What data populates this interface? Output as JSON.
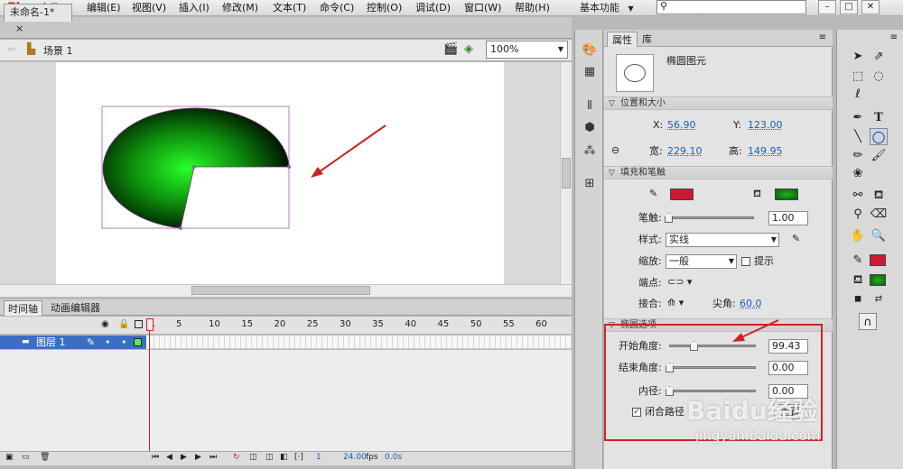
{
  "app": {
    "logo": "Fl",
    "workspace": "基本功能"
  },
  "menu": [
    "文件(F)",
    "编辑(E)",
    "视图(V)",
    "插入(I)",
    "修改(M)",
    "文本(T)",
    "命令(C)",
    "控制(O)",
    "调试(D)",
    "窗口(W)",
    "帮助(H)"
  ],
  "document": {
    "tab_title": "未命名-1*",
    "tab_close": "×",
    "scene": "场景 1",
    "zoom": "100%"
  },
  "timeline": {
    "tabs": [
      "时间轴",
      "动画编辑器"
    ],
    "frame_numbers": [
      "1",
      "5",
      "10",
      "15",
      "20",
      "25",
      "30",
      "35",
      "40",
      "45",
      "50",
      "55",
      "60"
    ],
    "layer_name": "图层 1",
    "footer": {
      "current_frame": "1",
      "fps": "24.00",
      "fps_unit": "fps",
      "time": "0.0s"
    }
  },
  "properties": {
    "tabs": [
      "属性",
      "库"
    ],
    "object_type": "椭圆图元",
    "position_section": "位置和大小",
    "x_label": "X:",
    "x_value": "56.90",
    "y_label": "Y:",
    "y_value": "123.00",
    "w_label": "宽:",
    "w_value": "229.10",
    "h_label": "高:",
    "h_value": "149.95",
    "fill_section": "填充和笔触",
    "stroke_color": "#cc1a33",
    "fill_color": "#22b322",
    "stroke_label": "笔触:",
    "stroke_value": "1.00",
    "style_label": "样式:",
    "style_value": "实线",
    "scale_label": "缩放:",
    "scale_value": "一般",
    "hint_label": "提示",
    "cap_label": "端点:",
    "join_label": "接合:",
    "miter_label": "尖角:",
    "miter_value": "60.0",
    "oval_section": "椭圆选项",
    "start_angle_label": "开始角度:",
    "start_angle_value": "99.43",
    "start_angle_fraction": 0.28,
    "end_angle_label": "结束角度:",
    "end_angle_value": "0.00",
    "end_angle_fraction": 0.0,
    "inner_radius_label": "内径:",
    "inner_radius_value": "0.00",
    "inner_radius_fraction": 0.0,
    "close_path_label": "闭合路径",
    "close_path_checked": true,
    "reset_label": "重置"
  },
  "watermark": {
    "brand": "Baidu经验",
    "url": "jingyan.baidu.com"
  }
}
